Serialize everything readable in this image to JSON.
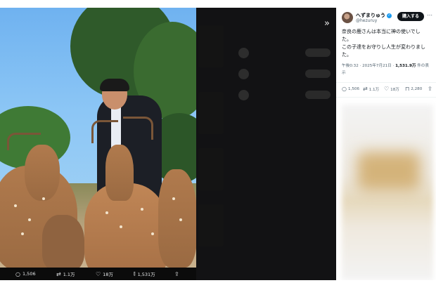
{
  "media": {
    "stats": {
      "replies": "1,506",
      "reposts": "1.1万",
      "likes": "18万",
      "views": "1,531万"
    }
  },
  "post": {
    "display_name": "へずまりゅう",
    "handle": "@hezuruy",
    "subscribe_label": "購入する",
    "text_line1": "奈良の鹿さんは本当に神の使いでし",
    "text_line2": "た。",
    "text_line3": "この子達をお守りし人生が変わりまし",
    "text_line4": "た。",
    "meta_time": "午後0:32 · 2025年7月21日 · ",
    "meta_views": "1,531.9万",
    "meta_suffix": " 件の表",
    "meta_suffix2": "示",
    "actions": {
      "replies": "1,506",
      "reposts": "1.1万",
      "likes": "18万",
      "bookmarks": "2,280"
    }
  },
  "colors": {
    "accent": "#1d9bf0",
    "button_bg": "#0f1419"
  },
  "icons": [
    "expand-icon",
    "reply-icon",
    "repost-icon",
    "like-icon",
    "views-icon",
    "share-icon",
    "bookmark-icon",
    "more-icon",
    "verified-icon"
  ]
}
